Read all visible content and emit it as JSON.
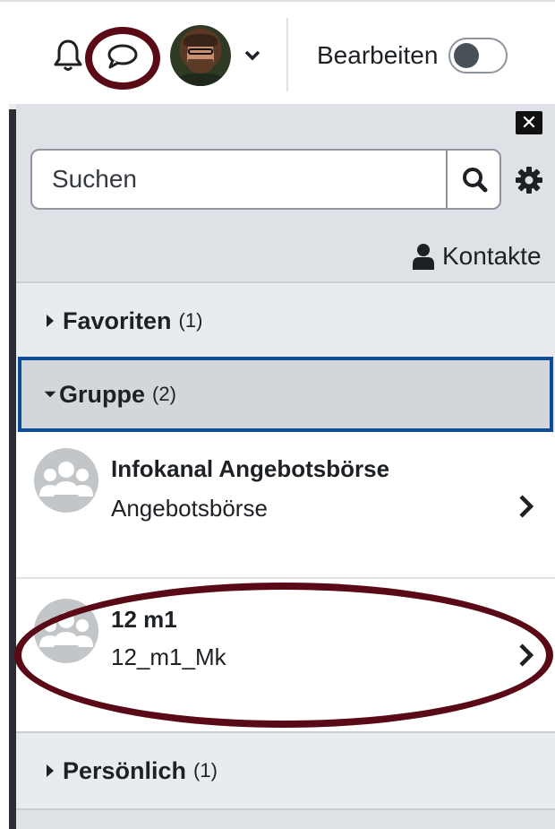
{
  "navbar": {
    "edit_label": "Bearbeiten",
    "edit_mode_on": false
  },
  "drawer": {
    "close_label": "✕",
    "search": {
      "placeholder": "Suchen"
    },
    "contacts_label": "Kontakte",
    "sections": {
      "favorites": {
        "title": "Favoriten",
        "count": "(1)",
        "expanded": false
      },
      "group": {
        "title": "Gruppe",
        "count": "(2)",
        "expanded": true
      },
      "personal": {
        "title": "Persönlich",
        "count": "(1)",
        "expanded": false
      }
    },
    "group_conversations": [
      {
        "name": "Infokanal Angebotsbörse",
        "subtitle": "Angebotsbörse"
      },
      {
        "name": "12 m1",
        "subtitle": "12_m1_Mk"
      }
    ]
  },
  "colors": {
    "highlight": "#5a0a16",
    "focus_border": "#0f4b96"
  },
  "icons": {
    "notifications": "bell-icon",
    "messages": "chat-bubble-icon",
    "user_menu": "chevron-down-icon",
    "close": "close-icon",
    "search": "search-icon",
    "settings": "gear-icon",
    "contacts": "user-icon",
    "group_avatar": "group-icon",
    "open_conversation": "chevron-right-icon"
  }
}
